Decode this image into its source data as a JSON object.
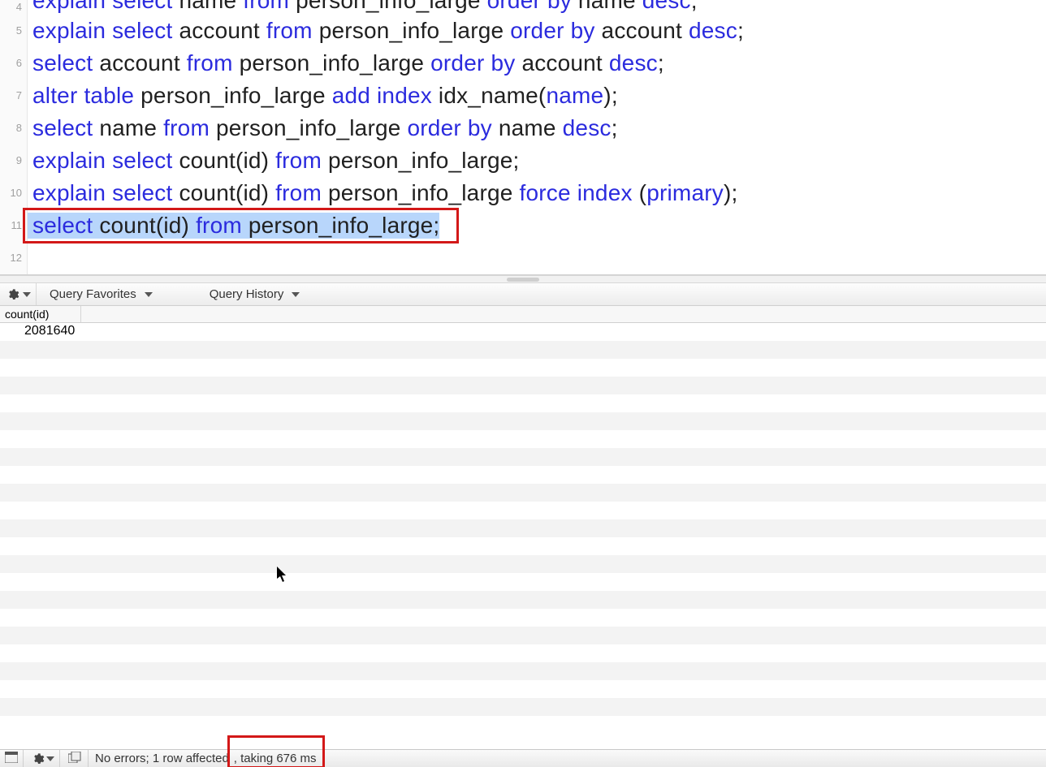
{
  "editor": {
    "lines": [
      {
        "n": 4,
        "tokens": [
          [
            "kw",
            "explain select"
          ],
          [
            "id",
            " name "
          ],
          [
            "kw",
            "from"
          ],
          [
            "id",
            " person_info_large "
          ],
          [
            "kw",
            "order by"
          ],
          [
            "id",
            " name "
          ],
          [
            "kw",
            "desc"
          ],
          [
            "pn",
            ";"
          ]
        ]
      },
      {
        "n": 5,
        "tokens": [
          [
            "kw",
            "explain select"
          ],
          [
            "id",
            " account "
          ],
          [
            "kw",
            "from"
          ],
          [
            "id",
            " person_info_large "
          ],
          [
            "kw",
            "order by"
          ],
          [
            "id",
            " account "
          ],
          [
            "kw",
            "desc"
          ],
          [
            "pn",
            ";"
          ]
        ]
      },
      {
        "n": 6,
        "tokens": [
          [
            "kw",
            "select"
          ],
          [
            "id",
            " account "
          ],
          [
            "kw",
            "from"
          ],
          [
            "id",
            " person_info_large "
          ],
          [
            "kw",
            "order by"
          ],
          [
            "id",
            " account "
          ],
          [
            "kw",
            "desc"
          ],
          [
            "pn",
            ";"
          ]
        ]
      },
      {
        "n": 7,
        "tokens": [
          [
            "kw",
            "alter table"
          ],
          [
            "id",
            " person_info_large "
          ],
          [
            "kw",
            "add index"
          ],
          [
            "id",
            " idx_name("
          ],
          [
            "kw",
            "name"
          ],
          [
            "id",
            ");"
          ]
        ]
      },
      {
        "n": 8,
        "tokens": [
          [
            "kw",
            "select"
          ],
          [
            "id",
            " name "
          ],
          [
            "kw",
            "from"
          ],
          [
            "id",
            " person_info_large "
          ],
          [
            "kw",
            "order by"
          ],
          [
            "id",
            " name "
          ],
          [
            "kw",
            "desc"
          ],
          [
            "pn",
            ";"
          ]
        ]
      },
      {
        "n": 9,
        "tokens": [
          [
            "kw",
            "explain select"
          ],
          [
            "id",
            " count(id) "
          ],
          [
            "kw",
            "from"
          ],
          [
            "id",
            " person_info_large;"
          ]
        ]
      },
      {
        "n": 10,
        "tokens": [
          [
            "kw",
            "explain select"
          ],
          [
            "id",
            " count(id) "
          ],
          [
            "kw",
            "from"
          ],
          [
            "id",
            " person_info_large "
          ],
          [
            "kw",
            "force index"
          ],
          [
            "id",
            " ("
          ],
          [
            "kw",
            "primary"
          ],
          [
            "id",
            ");"
          ]
        ]
      },
      {
        "n": 11,
        "tokens": [
          [
            "kw",
            "select"
          ],
          [
            "id",
            " count(id) "
          ],
          [
            "kw",
            "from"
          ],
          [
            "id",
            " person_info_large;"
          ]
        ]
      },
      {
        "n": 12,
        "tokens": []
      }
    ],
    "highlighted_line": 11
  },
  "mid_toolbar": {
    "favorites_label": "Query Favorites",
    "history_label": "Query History"
  },
  "results": {
    "column": "count(id)",
    "value": "2081640",
    "blank_rows": 22
  },
  "statusbar": {
    "message_prefix": "No errors; 1 row affected",
    "message_timing": ", taking 676 ms"
  }
}
